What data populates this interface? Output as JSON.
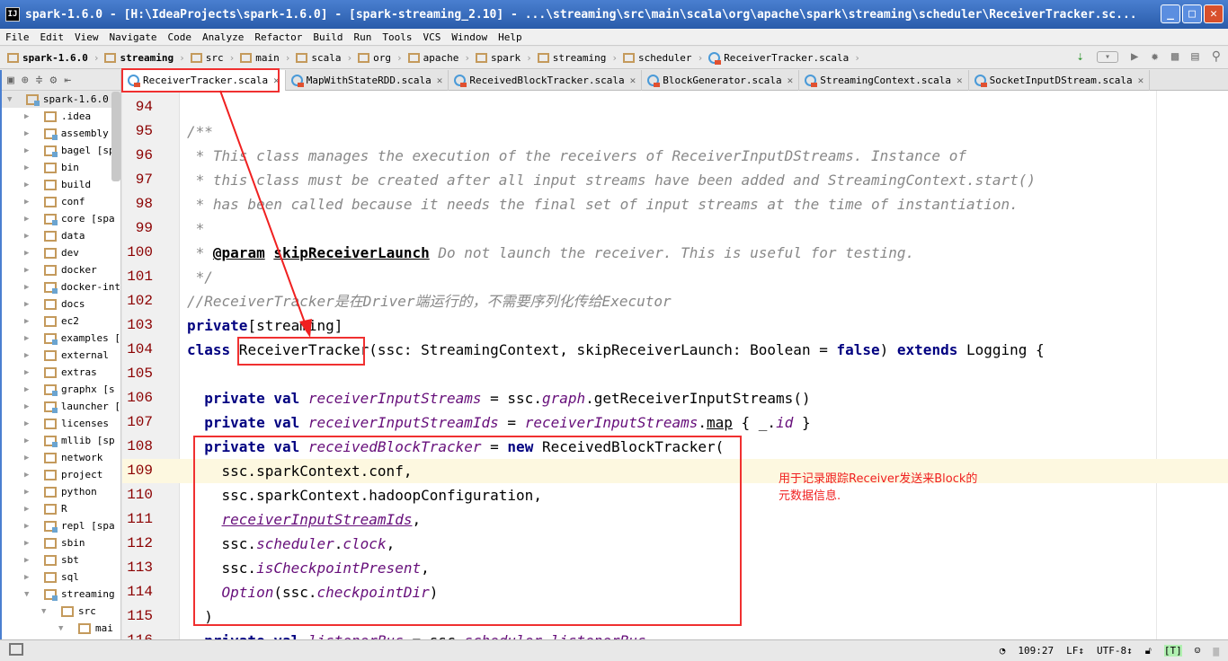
{
  "window": {
    "title": "spark-1.6.0 - [H:\\IdeaProjects\\spark-1.6.0] - [spark-streaming_2.10] - ...\\streaming\\src\\main\\scala\\org\\apache\\spark\\streaming\\scheduler\\ReceiverTracker.sc...",
    "logo": "IJ"
  },
  "menu": [
    "File",
    "Edit",
    "View",
    "Navigate",
    "Code",
    "Analyze",
    "Refactor",
    "Build",
    "Run",
    "Tools",
    "VCS",
    "Window",
    "Help"
  ],
  "breadcrumbs": [
    {
      "label": "spark-1.6.0",
      "bold": true
    },
    {
      "label": "streaming",
      "bold": true
    },
    {
      "label": "src"
    },
    {
      "label": "main"
    },
    {
      "label": "scala"
    },
    {
      "label": "org"
    },
    {
      "label": "apache"
    },
    {
      "label": "spark"
    },
    {
      "label": "streaming"
    },
    {
      "label": "scheduler"
    },
    {
      "label": "ReceiverTracker.scala",
      "file": true
    }
  ],
  "tabs": [
    {
      "label": "ReceiverTracker.scala",
      "active": true
    },
    {
      "label": "MapWithStateRDD.scala"
    },
    {
      "label": "ReceivedBlockTracker.scala"
    },
    {
      "label": "BlockGenerator.scala"
    },
    {
      "label": "StreamingContext.scala"
    },
    {
      "label": "SocketInputDStream.scala"
    }
  ],
  "project_tree": [
    {
      "label": "spark-1.6.0 [",
      "open": true,
      "mod": true,
      "level": 0
    },
    {
      "label": ".idea",
      "level": 1
    },
    {
      "label": "assembly [",
      "mod": true,
      "level": 1
    },
    {
      "label": "bagel [sp",
      "mod": true,
      "level": 1
    },
    {
      "label": "bin",
      "level": 1
    },
    {
      "label": "build",
      "level": 1
    },
    {
      "label": "conf",
      "level": 1
    },
    {
      "label": "core [spa",
      "mod": true,
      "level": 1
    },
    {
      "label": "data",
      "level": 1
    },
    {
      "label": "dev",
      "level": 1
    },
    {
      "label": "docker",
      "level": 1
    },
    {
      "label": "docker-int",
      "mod": true,
      "level": 1
    },
    {
      "label": "docs",
      "level": 1
    },
    {
      "label": "ec2",
      "level": 1
    },
    {
      "label": "examples [",
      "mod": true,
      "level": 1
    },
    {
      "label": "external",
      "level": 1
    },
    {
      "label": "extras",
      "level": 1
    },
    {
      "label": "graphx [s",
      "mod": true,
      "level": 1
    },
    {
      "label": "launcher [",
      "mod": true,
      "level": 1
    },
    {
      "label": "licenses",
      "level": 1
    },
    {
      "label": "mllib [sp",
      "mod": true,
      "level": 1
    },
    {
      "label": "network",
      "level": 1
    },
    {
      "label": "project",
      "level": 1
    },
    {
      "label": "python",
      "level": 1
    },
    {
      "label": "R",
      "level": 1
    },
    {
      "label": "repl [spa",
      "mod": true,
      "level": 1
    },
    {
      "label": "sbin",
      "level": 1
    },
    {
      "label": "sbt",
      "level": 1
    },
    {
      "label": "sql",
      "level": 1
    },
    {
      "label": "streaming",
      "open": true,
      "mod": true,
      "level": 1
    },
    {
      "label": "src",
      "open": true,
      "level": 2
    },
    {
      "label": "mai",
      "open": true,
      "level": 3
    }
  ],
  "code": [
    {
      "n": "94",
      "t": []
    },
    {
      "n": "95",
      "t": [
        [
          "/**",
          "cm"
        ]
      ]
    },
    {
      "n": "96",
      "t": [
        [
          " * This class manages the execution of the receivers of ReceiverInputDStreams. Instance of",
          "cm"
        ]
      ]
    },
    {
      "n": "97",
      "t": [
        [
          " * this class must be created after all input streams have been added and StreamingContext.start()",
          "cm"
        ]
      ]
    },
    {
      "n": "98",
      "t": [
        [
          " * has been called because it needs the final set of input streams at the time of instantiation.",
          "cm"
        ]
      ]
    },
    {
      "n": "99",
      "t": [
        [
          " *",
          "cm"
        ]
      ]
    },
    {
      "n": "100",
      "t": [
        [
          " * ",
          "cm"
        ],
        [
          "@param",
          "tag"
        ],
        [
          " ",
          "cm"
        ],
        [
          "skipReceiverLaunch",
          "tag"
        ],
        [
          " Do not launch the receiver. This is useful for testing.",
          "cm"
        ]
      ]
    },
    {
      "n": "101",
      "t": [
        [
          " */",
          "cm"
        ]
      ]
    },
    {
      "n": "102",
      "t": [
        [
          "//ReceiverTracker是在Driver端运行的，不需要序列化传给Executor",
          "cm"
        ]
      ]
    },
    {
      "n": "103",
      "t": [
        [
          "private",
          "kw"
        ],
        [
          "[streaming]",
          "plain"
        ]
      ]
    },
    {
      "n": "104",
      "t": [
        [
          "class",
          "kw"
        ],
        [
          " ReceiverTracker(ssc: StreamingContext, skipReceiverLaunch: Boolean = ",
          "plain"
        ],
        [
          "false",
          "kw"
        ],
        [
          ") ",
          "plain"
        ],
        [
          "extends",
          "kw"
        ],
        [
          " Logging {",
          "plain"
        ]
      ]
    },
    {
      "n": "105",
      "t": []
    },
    {
      "n": "106",
      "t": [
        [
          "  private val ",
          "kw"
        ],
        [
          "receiverInputStreams",
          "fld"
        ],
        [
          " = ssc.",
          "plain"
        ],
        [
          "graph",
          "fld"
        ],
        [
          ".getReceiverInputStreams()",
          "plain"
        ]
      ]
    },
    {
      "n": "107",
      "t": [
        [
          "  private val ",
          "kw"
        ],
        [
          "receiverInputStreamIds",
          "fld"
        ],
        [
          " = ",
          "plain"
        ],
        [
          "receiverInputStreams",
          "fld"
        ],
        [
          ".",
          "plain"
        ],
        [
          "map",
          "plain ul"
        ],
        [
          " { _.",
          "plain"
        ],
        [
          "id",
          "fld"
        ],
        [
          " }",
          "plain"
        ]
      ]
    },
    {
      "n": "108",
      "t": [
        [
          "  private val ",
          "kw"
        ],
        [
          "receivedBlockTracker",
          "fld"
        ],
        [
          " = ",
          "plain"
        ],
        [
          "new",
          "kw"
        ],
        [
          " ReceivedBlockTracker(",
          "plain"
        ]
      ]
    },
    {
      "n": "109",
      "t": [
        [
          "    ssc.sparkContext.conf,",
          "plain"
        ]
      ],
      "current": true
    },
    {
      "n": "110",
      "t": [
        [
          "    ssc.sparkContext.hadoopConfiguration,",
          "plain"
        ]
      ]
    },
    {
      "n": "111",
      "t": [
        [
          "    ",
          "plain"
        ],
        [
          "receiverInputStreamIds",
          "fld ul"
        ],
        [
          ",",
          "plain"
        ]
      ]
    },
    {
      "n": "112",
      "t": [
        [
          "    ssc.",
          "plain"
        ],
        [
          "scheduler",
          "fld"
        ],
        [
          ".",
          "plain"
        ],
        [
          "clock",
          "fld"
        ],
        [
          ",",
          "plain"
        ]
      ]
    },
    {
      "n": "113",
      "t": [
        [
          "    ssc.",
          "plain"
        ],
        [
          "isCheckpointPresent",
          "fld"
        ],
        [
          ",",
          "plain"
        ]
      ]
    },
    {
      "n": "114",
      "t": [
        [
          "    ",
          "plain"
        ],
        [
          "Option",
          "fld"
        ],
        [
          "(ssc.",
          "plain"
        ],
        [
          "checkpointDir",
          "fld"
        ],
        [
          ")",
          "plain"
        ]
      ]
    },
    {
      "n": "115",
      "t": [
        [
          "  )",
          "plain"
        ]
      ]
    },
    {
      "n": "116",
      "t": [
        [
          "  private val ",
          "kw"
        ],
        [
          "listenerBus",
          "fld"
        ],
        [
          " = ssc.",
          "plain"
        ],
        [
          "scheduler",
          "fld"
        ],
        [
          ".",
          "plain"
        ],
        [
          "listenerBus",
          "fld"
        ]
      ]
    }
  ],
  "annotation": {
    "note_line1": "用于记录跟踪Receiver发送来Block的",
    "note_line2": "元数据信息.",
    "color": "#f03030"
  },
  "status": {
    "position": "109:27",
    "line_sep": "LF↕",
    "encoding": "UTF-8↕",
    "mode": "[T]"
  }
}
